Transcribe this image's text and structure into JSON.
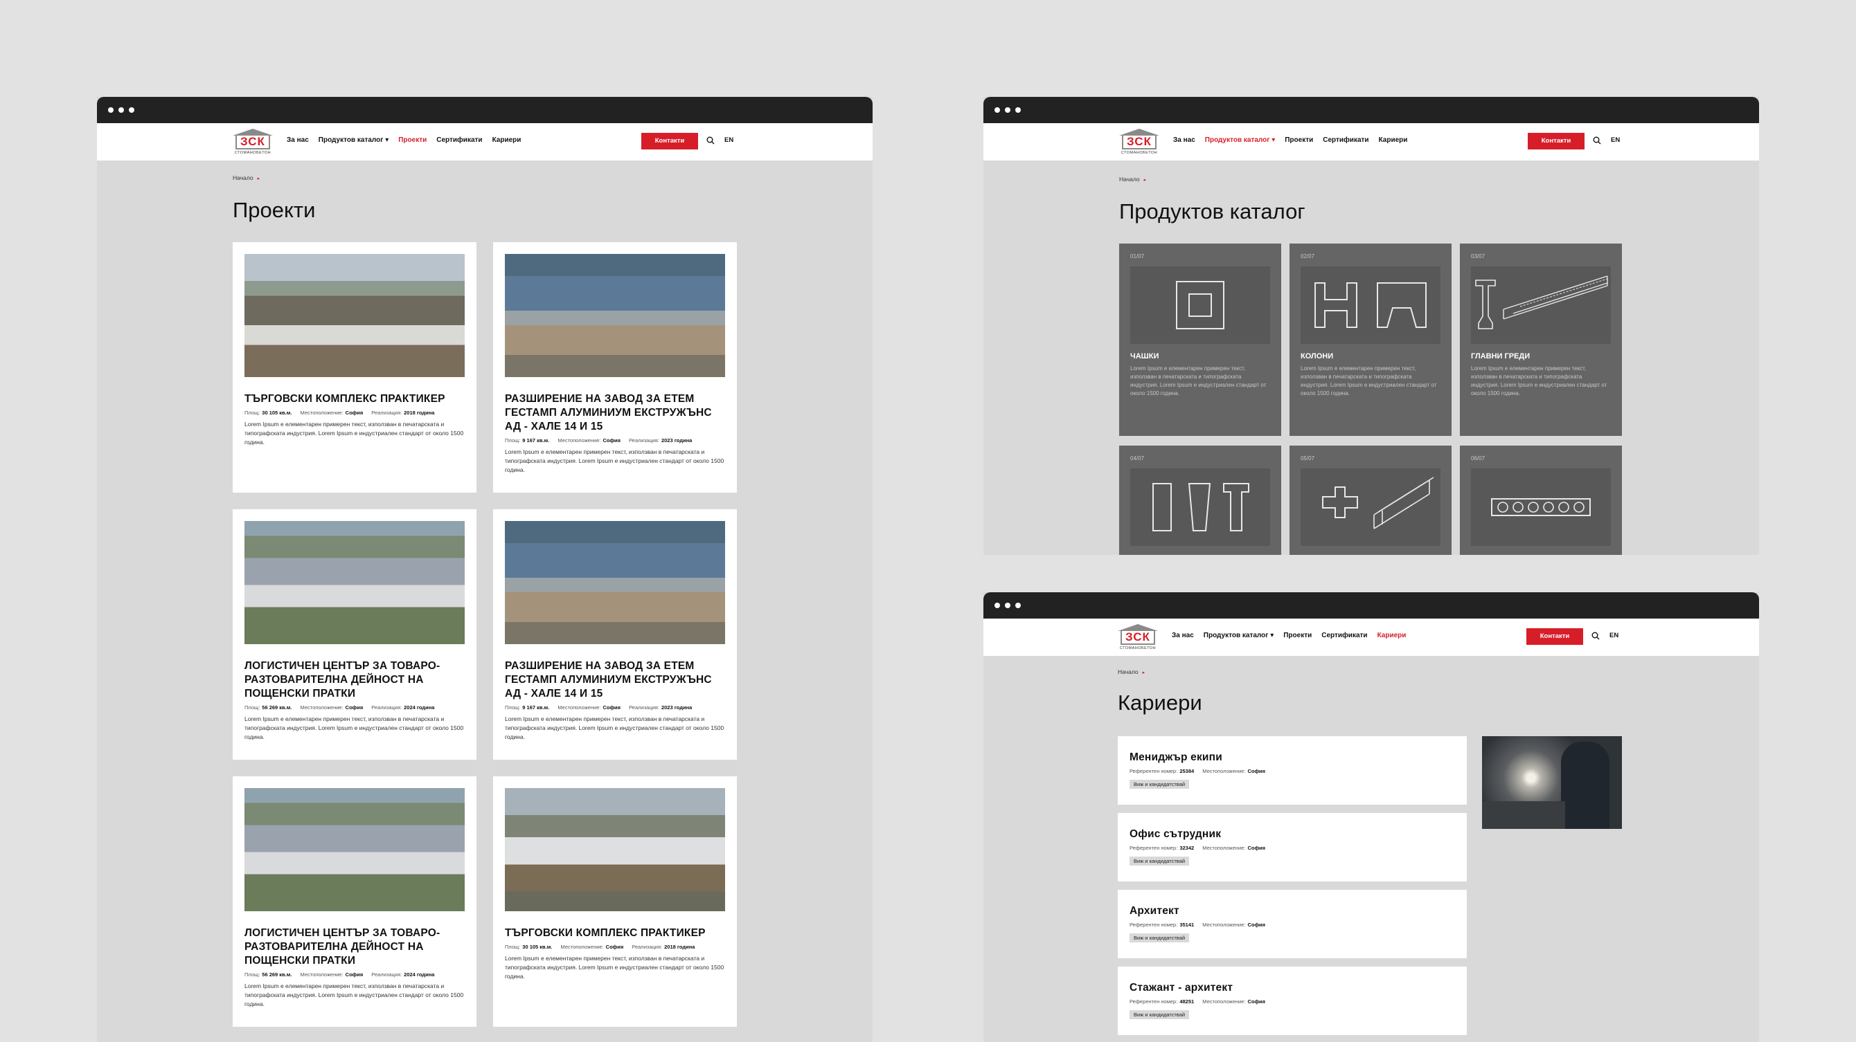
{
  "nav": {
    "logo": "ЗСК",
    "logo_sub": "СТОМАНОБЕТОН",
    "items": [
      "За нас",
      "Продуктов каталог",
      "Проекти",
      "Сертификати",
      "Кариери"
    ],
    "dropdown_arrow": "▾",
    "contact": "Контакти",
    "lang": "EN"
  },
  "breadcrumb": {
    "home": "Начало",
    "arrow": "▸"
  },
  "projects": {
    "title": "Проекти",
    "meta_labels": {
      "area": "Площ:",
      "location": "Местоположение:",
      "year": "Реализация:"
    },
    "cards": [
      {
        "title": "Търговски комплекс Практикер",
        "area": "30 105 кв.м.",
        "location": "София",
        "year": "2018 година",
        "desc": "Lorem Ipsum е елементарен примерен текст, използван в печатарската и типографската индустрия. Lorem Ipsum е индустриален стандарт от около 1500 година."
      },
      {
        "title": "Разширение на завод за Етем Гестамп Алуминиум Екстружънс АД - хале 14 и 15",
        "area": "9 167 кв.м.",
        "location": "София",
        "year": "2023 година",
        "desc": "Lorem Ipsum е елементарен примерен текст, използван в печатарската и типографската индустрия. Lorem Ipsum е индустриален стандарт от около 1500 година."
      },
      {
        "title": "Логистичен център за товаро-разтоварителна дейност на пощенски пратки",
        "area": "56 269 кв.м.",
        "location": "София",
        "year": "2024 година",
        "desc": "Lorem Ipsum е елементарен примерен текст, използван в печатарската и типографската индустрия. Lorem Ipsum е индустриален стандарт от около 1500 година."
      },
      {
        "title": "Разширение на завод за Етем Гестамп Алуминиум Екстружънс АД - хале 14 и 15",
        "area": "9 167 кв.м.",
        "location": "София",
        "year": "2023 година",
        "desc": "Lorem Ipsum е елементарен примерен текст, използван в печатарската и типографската индустрия. Lorem Ipsum е индустриален стандарт от около 1500 година."
      },
      {
        "title": "Логистичен център за товаро-разтоварителна дейност на пощенски пратки",
        "area": "56 269 кв.м.",
        "location": "София",
        "year": "2024 година",
        "desc": "Lorem Ipsum е елементарен примерен текст, използван в печатарската и типографската индустрия. Lorem Ipsum е индустриален стандарт от около 1500 година."
      },
      {
        "title": "Търговски комплекс Практикер",
        "area": "30 105 кв.м.",
        "location": "София",
        "year": "2018 година",
        "desc": "Lorem Ipsum е елементарен примерен текст, използван в печатарската и типографската индустрия. Lorem Ipsum е индустриален стандарт от около 1500 година."
      }
    ]
  },
  "catalog": {
    "title": "Продуктов каталог",
    "items": [
      {
        "num": "01/07",
        "name": "Чашки",
        "icon": "socket-icon",
        "desc": "Lorem Ipsum е елементарен примерен текст, използван в печатарската и типографската индустрия. Lorem Ipsum е индустриален стандарт от около 1500 година."
      },
      {
        "num": "02/07",
        "name": "Колони",
        "icon": "column-icon",
        "desc": "Lorem Ipsum е елементарен примерен текст, използван в печатарската и типографската индустрия. Lorem Ipsum е индустриален стандарт от около 1500 година."
      },
      {
        "num": "03/07",
        "name": "Главни греди",
        "icon": "beam-icon",
        "desc": "Lorem Ipsum е елементарен примерен текст, използван в печатарската и типографската индустрия. Lorem Ipsum е индустриален стандарт от около 1500 година."
      },
      {
        "num": "04/07",
        "icon": "pillar-icon"
      },
      {
        "num": "05/07",
        "icon": "cross-beam-icon"
      },
      {
        "num": "06/07",
        "icon": "hollow-slab-icon"
      }
    ]
  },
  "careers": {
    "title": "Кариери",
    "ref_label": "Референтен номер:",
    "location_label": "Местоположение:",
    "tag": "Виж и кандидатствай",
    "jobs": [
      {
        "title": "Мениджър екипи",
        "ref": "25384",
        "location": "София"
      },
      {
        "title": "Офис сътрудник",
        "ref": "32342",
        "location": "София"
      },
      {
        "title": "Архитект",
        "ref": "35141",
        "location": "София"
      },
      {
        "title": "Стажант - архитект",
        "ref": "48251",
        "location": "София"
      }
    ]
  }
}
